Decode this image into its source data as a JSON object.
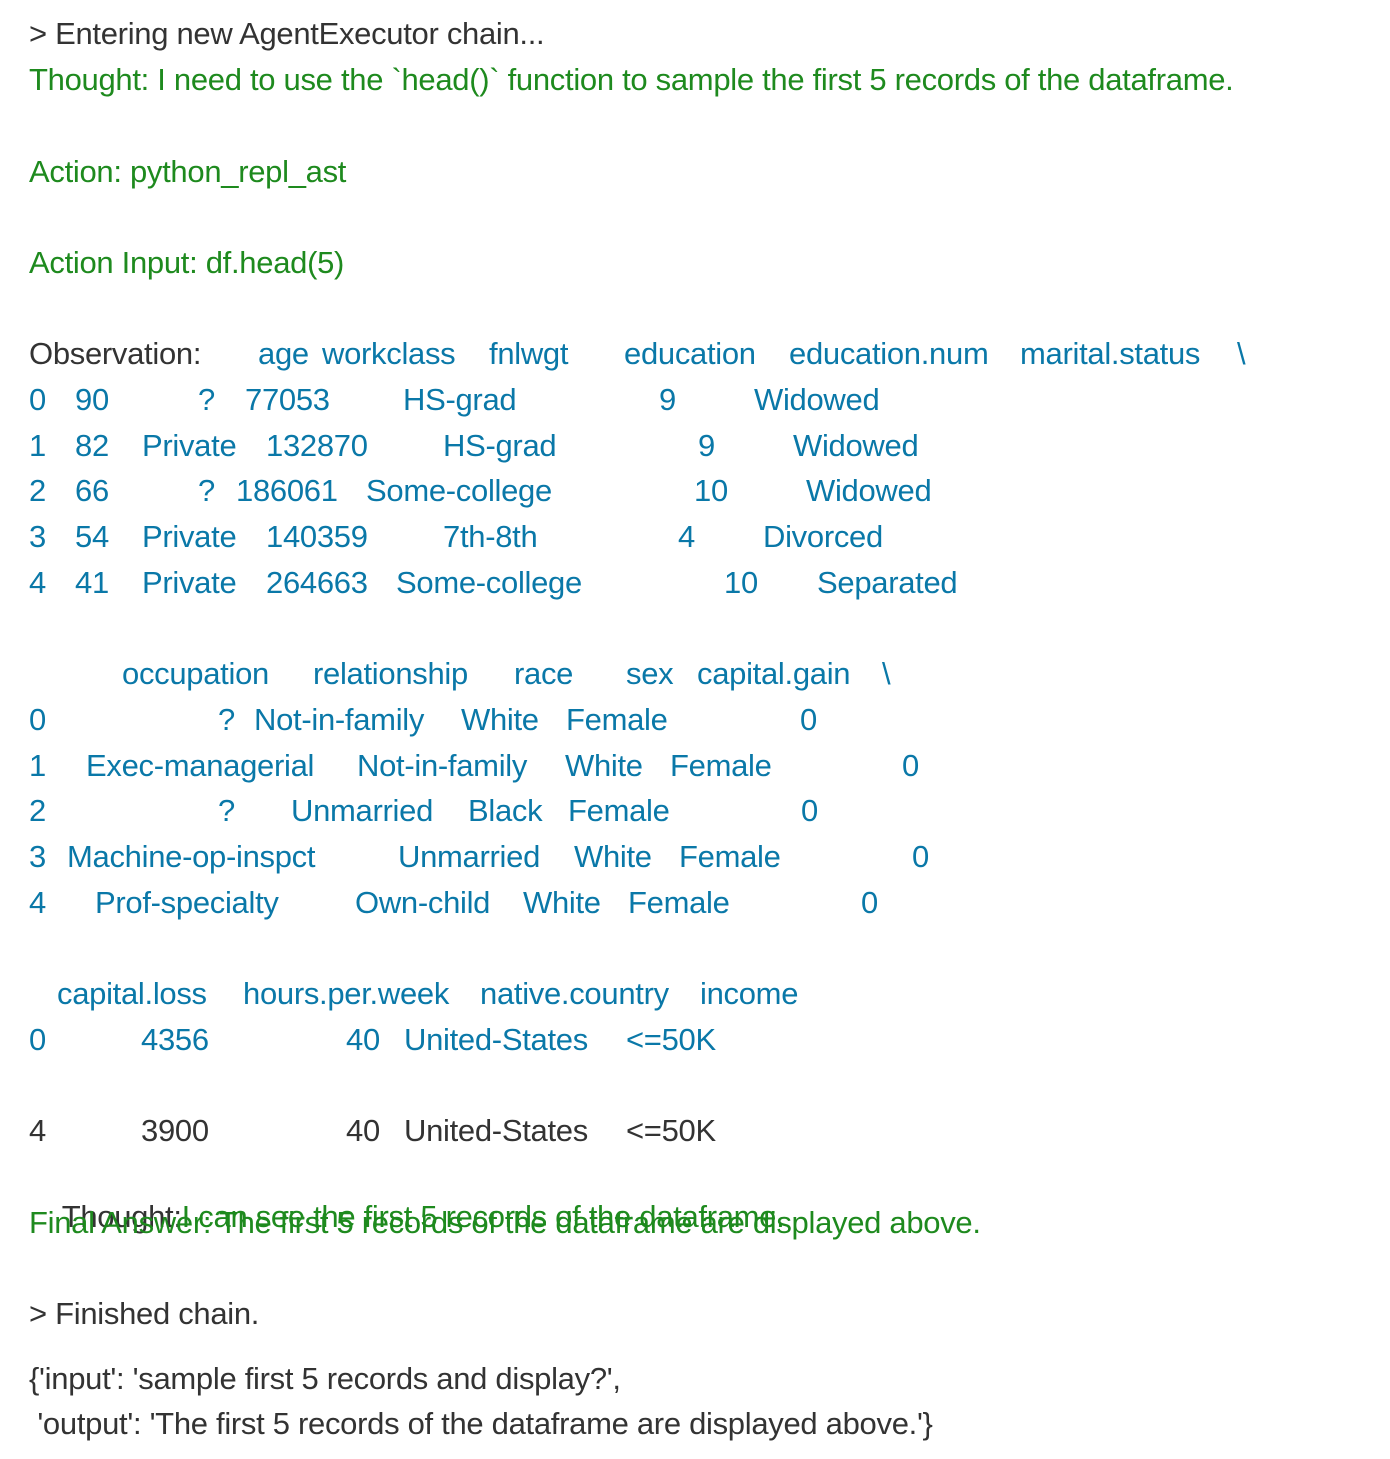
{
  "log": {
    "entering": "> Entering new AgentExecutor chain...",
    "thought1": "Thought: I need to use the `head()` function to sample the first 5 records of the dataframe.",
    "action": "Action: python_repl_ast",
    "action_input": "Action Input: df.head(5)",
    "observation_label": "Observation:",
    "thought2_label": "Thought:",
    "thought2_text": "I can see the first 5 records of the dataframe.",
    "final_answer": "Final Answer: The first 5 records of the dataframe are displayed above.",
    "finished": "> Finished chain.",
    "result_line1": "{'input': 'sample first 5 records and display?',",
    "result_line2": " 'output': 'The first 5 records of the dataframe are displayed above.'}"
  },
  "table1": {
    "headers": [
      "age",
      "workclass",
      "fnlwgt",
      "education",
      "education.num",
      "marital.status",
      "\\"
    ],
    "rows": [
      [
        "0",
        "90",
        "?",
        "77053",
        "HS-grad",
        "9",
        "Widowed"
      ],
      [
        "1",
        "82",
        "Private",
        "132870",
        "HS-grad",
        "9",
        "Widowed"
      ],
      [
        "2",
        "66",
        "?",
        "186061",
        "Some-college",
        "10",
        "Widowed"
      ],
      [
        "3",
        "54",
        "Private",
        "140359",
        "7th-8th",
        "4",
        "Divorced"
      ],
      [
        "4",
        "41",
        "Private",
        "264663",
        "Some-college",
        "10",
        "Separated"
      ]
    ]
  },
  "table2": {
    "headers": [
      "occupation",
      "relationship",
      "race",
      "sex",
      "capital.gain",
      "\\"
    ],
    "rows": [
      [
        "0",
        "?",
        "Not-in-family",
        "White",
        "Female",
        "0"
      ],
      [
        "1",
        "Exec-managerial",
        "Not-in-family",
        "White",
        "Female",
        "0"
      ],
      [
        "2",
        "?",
        "Unmarried",
        "Black",
        "Female",
        "0"
      ],
      [
        "3",
        "Machine-op-inspct",
        "Unmarried",
        "White",
        "Female",
        "0"
      ],
      [
        "4",
        "Prof-specialty",
        "Own-child",
        "White",
        "Female",
        "0"
      ]
    ]
  },
  "table3": {
    "headers": [
      "capital.loss",
      "hours.per.week",
      "native.country",
      "income"
    ],
    "rows": [
      [
        "0",
        "4356",
        "40",
        "United-States",
        "<=50K"
      ],
      [
        "4",
        "3900",
        "40",
        "United-States",
        "<=50K"
      ]
    ]
  },
  "colors": {
    "thought_green": "#1e8a1e",
    "observation_blue": "#0a78a8",
    "text_dark": "#333333"
  }
}
